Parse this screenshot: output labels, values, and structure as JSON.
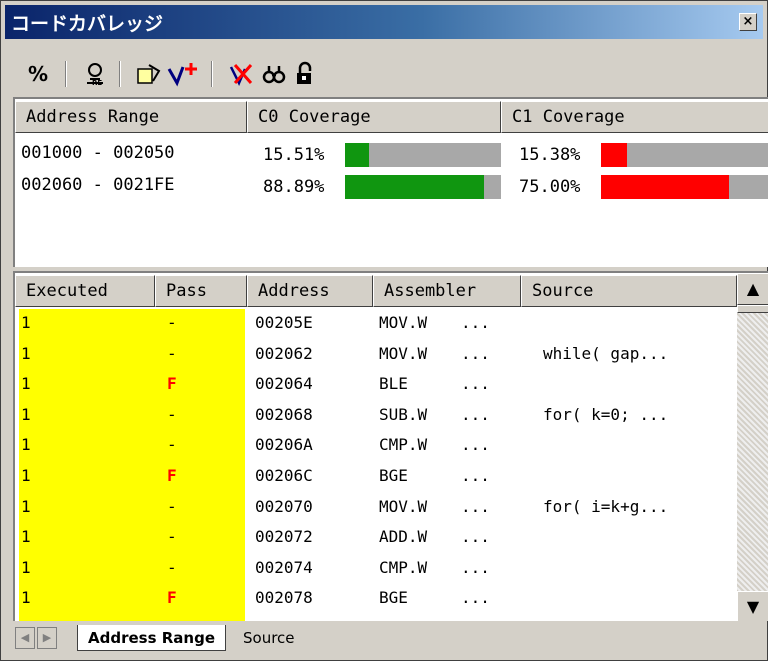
{
  "window": {
    "title": "コードカバレッジ",
    "close_label": "×"
  },
  "toolbar": {
    "percent_label": "%",
    "items": [
      "percent-icon",
      "filter-icon",
      "refresh-icon",
      "add-range-icon",
      "delete-icon",
      "find-icon",
      "lock-icon"
    ]
  },
  "range_table": {
    "headers": [
      "Address Range",
      "C0 Coverage",
      "C1 Coverage"
    ],
    "rows": [
      {
        "range": "001000 - 002050",
        "c0_text": "15.51%",
        "c0": 15.51,
        "c1_text": "15.38%",
        "c1": 15.38
      },
      {
        "range": "002060 - 0021FE",
        "c0_text": "88.89%",
        "c0": 88.89,
        "c1_text": "75.00%",
        "c1": 75.0
      }
    ],
    "colors": {
      "c0": "#109610",
      "c1": "#ff0000",
      "track": "#a8a8a8"
    }
  },
  "exec_table": {
    "headers": [
      "Executed",
      "Pass",
      "Address",
      "Assembler",
      "Source"
    ],
    "rows": [
      {
        "executed": "1",
        "pass": "-",
        "address": "00205E",
        "asm_op": "MOV.W",
        "asm_rest": "...",
        "source": ""
      },
      {
        "executed": "1",
        "pass": "-",
        "address": "002062",
        "asm_op": "MOV.W",
        "asm_rest": "...",
        "source": "while( gap..."
      },
      {
        "executed": "1",
        "pass": "F",
        "address": "002064",
        "asm_op": "BLE",
        "asm_rest": "...",
        "source": ""
      },
      {
        "executed": "1",
        "pass": "-",
        "address": "002068",
        "asm_op": "SUB.W",
        "asm_rest": "...",
        "source": "for( k=0; ..."
      },
      {
        "executed": "1",
        "pass": "-",
        "address": "00206A",
        "asm_op": "CMP.W",
        "asm_rest": "...",
        "source": ""
      },
      {
        "executed": "1",
        "pass": "F",
        "address": "00206C",
        "asm_op": "BGE",
        "asm_rest": "...",
        "source": ""
      },
      {
        "executed": "1",
        "pass": "-",
        "address": "002070",
        "asm_op": "MOV.W",
        "asm_rest": "...",
        "source": "for( i=k+g..."
      },
      {
        "executed": "1",
        "pass": "-",
        "address": "002072",
        "asm_op": "ADD.W",
        "asm_rest": "...",
        "source": ""
      },
      {
        "executed": "1",
        "pass": "-",
        "address": "002074",
        "asm_op": "CMP.W",
        "asm_rest": "...",
        "source": ""
      },
      {
        "executed": "1",
        "pass": "F",
        "address": "002078",
        "asm_op": "BGE",
        "asm_rest": "...",
        "source": ""
      }
    ],
    "highlight_color": "#ffff00"
  },
  "tabs": {
    "items": [
      "Address Range",
      "Source"
    ],
    "active": "Address Range"
  }
}
